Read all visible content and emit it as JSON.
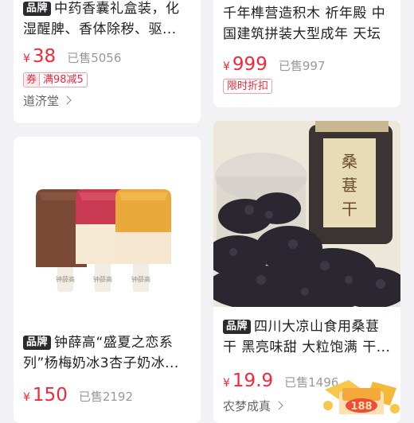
{
  "cards": [
    {
      "brand": "品牌",
      "title": "中药香囊礼盒装，化湿醒脾、香体除秽、驱...",
      "currency": "¥",
      "price": "38",
      "sold": "已售5056",
      "coupon_label": "券",
      "coupon_text": "满98减5",
      "shop": "道济堂"
    },
    {
      "title": "千年榫营造积木 祈年殿 中国建筑拼装大型成年 天坛",
      "currency": "¥",
      "price": "999",
      "sold": "已售997",
      "tag": "限时折扣"
    },
    {
      "brand": "品牌",
      "title": "钟薛高“盛夏之恋系列”杨梅奶冰3杏子奶冰...",
      "currency": "¥",
      "price": "150",
      "sold": "已售2192",
      "stick_text": "钟薛高"
    },
    {
      "brand": "品牌",
      "title": "四川大凉山食用桑葚干 黑亮味甜 大粒饱满 干...",
      "currency": "¥",
      "price": "19.9",
      "sold": "已售1496",
      "shop": "农梦成真",
      "jar_label": "桑葚干",
      "badge_number": "188"
    }
  ]
}
